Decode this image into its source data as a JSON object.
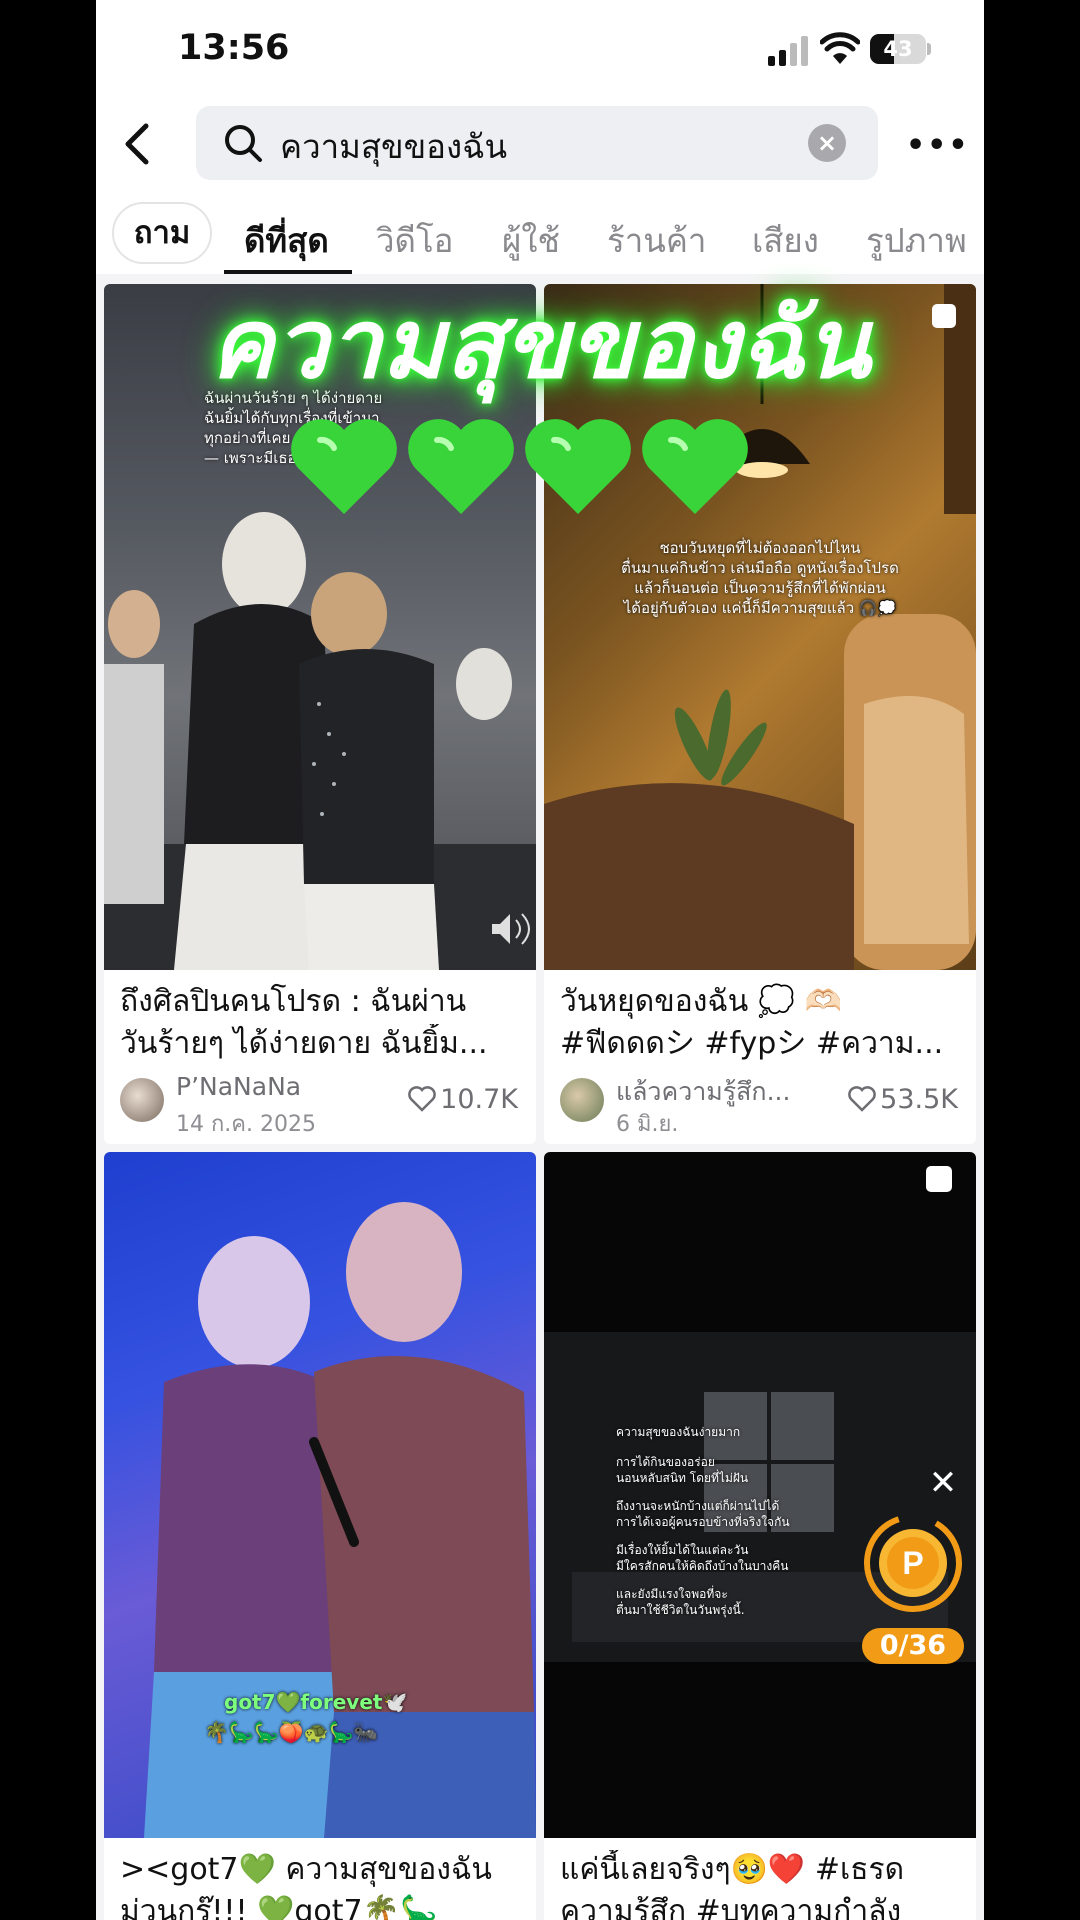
{
  "status_bar": {
    "time": "13:56",
    "battery": "43",
    "battery_level": 0.43
  },
  "search": {
    "query": "ความสุขของฉัน",
    "clear_label": "×",
    "more_label": "•••"
  },
  "tabs": [
    {
      "label": "ถาม"
    },
    {
      "label": "ดีที่สุด",
      "active": true
    },
    {
      "label": "วิดีโอ"
    },
    {
      "label": "ผู้ใช้"
    },
    {
      "label": "ร้านค้า"
    },
    {
      "label": "เสียง"
    },
    {
      "label": "รูปภาพ"
    }
  ],
  "overlay": {
    "headline": "ความสุขของฉัน",
    "hearts": [
      "💚",
      "💚",
      "💚",
      "💚"
    ]
  },
  "results": [
    {
      "caption_1": "ถึงศิลปินคนโปรด : ฉันผ่าน",
      "caption_2": "วันร้ายๆ ได้ง่ายดาย ฉันยิ้ม...",
      "author": "P’NaNaNa",
      "date": "14 ก.ค. 2025",
      "likes": "10.7K",
      "overlay_lines": [
        "ฉันผ่านวันร้าย ๆ ได้ง่ายดาย",
        "ฉันยิ้มได้กับทุกเรื่องที่เข้ามา",
        "ทุกอย่างที่เคย",
        "— เพราะมีเธอ"
      ]
    },
    {
      "caption_1": "วันหยุดของฉัน 💭 🫶🏻",
      "caption_2": "#ฟีดดดシ #fypシ #ความ...",
      "author": "แล้วความรู้สึก...",
      "date": "6 มิ.ย.",
      "likes": "53.5K",
      "overlay_lines": [
        "ชอบวันหยุดที่ไม่ต้องออกไปไหน",
        "ตื่นมาแค่กินข้าว เล่นมือถือ ดูหนังเรื่องโปรด",
        "แล้วก็นอนต่อ เป็นความรู้สึกที่ได้พักผ่อน",
        "ได้อยู่กับตัวเอง แค่นี้ก็มีความสุขแล้ว 🎧💭"
      ]
    },
    {
      "caption_1": "><got7💚 ความสุขของฉัน",
      "caption_2": "ม่วนกรุ๊!!! 💚got7🌴🦕",
      "overlay_lines": [
        "got7💚forevet🕊️",
        "🌴🦕🦕🍑🐢🦕🐜"
      ]
    },
    {
      "caption_1": "แค่นี้เลยจริงๆ🥹❤️ #เธรด",
      "caption_2": "ความรู้สึก #บทความกำลัง",
      "overlay_lines": [
        "ความสุขของฉันง่ายมาก",
        "การได้กินของอร่อย",
        "นอนหลับสนิท โดยที่ไม่ฝัน",
        "ถึงงานจะหนักบ้างแต่ก็ผ่านไปได้",
        "การได้เจอผู้คนรอบข้างที่จริงใจกัน",
        "มีเรื่องให้ยิ้มได้ในแต่ละวัน",
        "มีใครสักคนให้คิดถึงบ้างในบางคืน",
        "และยังมีแรงใจพอที่จะ",
        "ตื่นมาใช้ชีวิตในวันพรุ่งนี้."
      ]
    }
  ],
  "coin_widget": {
    "close_label": "✕",
    "icon_letter": "P",
    "count": "0/36",
    "color": "#f29b17"
  },
  "colors": {
    "glow_green": "#3cff3c",
    "heart": "#e5283b"
  }
}
